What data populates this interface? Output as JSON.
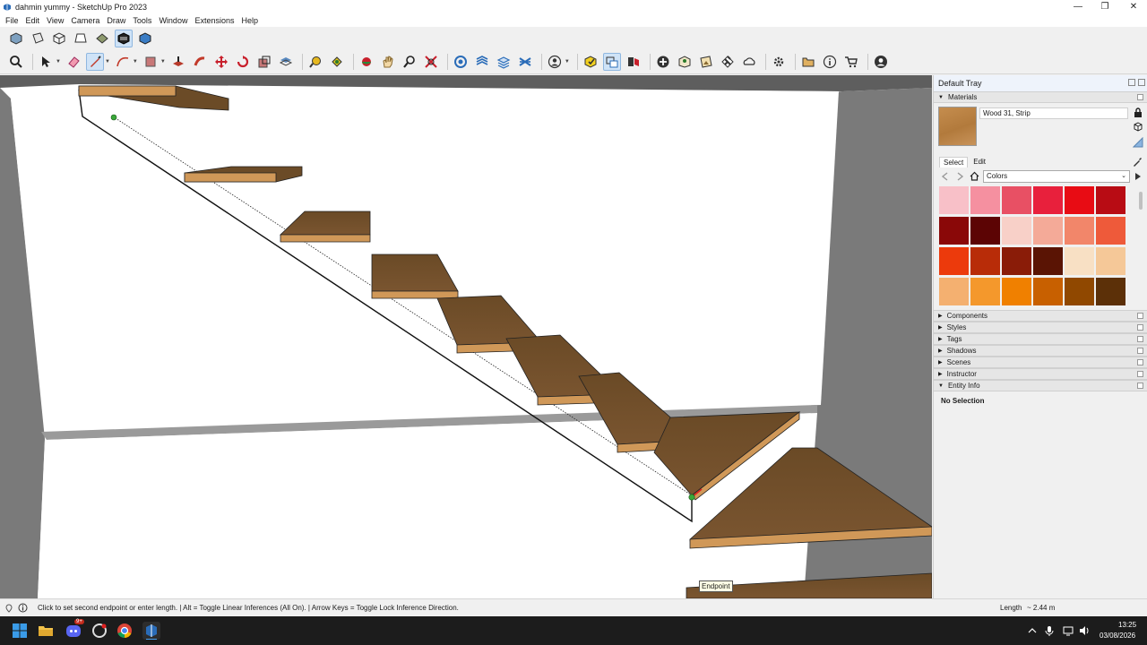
{
  "window": {
    "title": "dahmin yummy - SketchUp Pro 2023"
  },
  "menu": [
    "File",
    "Edit",
    "View",
    "Camera",
    "Draw",
    "Tools",
    "Window",
    "Extensions",
    "Help"
  ],
  "viewport": {
    "inference_tooltip": "Endpoint"
  },
  "tray": {
    "title": "Default Tray",
    "materials": {
      "label": "Materials",
      "current_material": "Wood 31, Strip",
      "tab_select": "Select",
      "tab_edit": "Edit",
      "library": "Colors",
      "swatches": [
        "#f8c0c8",
        "#f590a0",
        "#e85064",
        "#e8203c",
        "#e80c14",
        "#b80c14",
        "#8a0808",
        "#5c0404",
        "#f8d0c8",
        "#f4aa98",
        "#f2866a",
        "#ee5a3a",
        "#ec3a0c",
        "#b82c08",
        "#8a1c08",
        "#5a1404",
        "#f8e0c4",
        "#f5c898",
        "#f4b070",
        "#f4982c",
        "#f08000",
        "#c86000",
        "#904800",
        "#5c3008"
      ]
    },
    "panels": [
      "Components",
      "Styles",
      "Tags",
      "Shadows",
      "Scenes",
      "Instructor"
    ],
    "entity_info": {
      "label": "Entity Info",
      "value": "No Selection"
    }
  },
  "statusbar": {
    "message": "Click to set second endpoint or enter length. | Alt = Toggle Linear Inferences (All On). | Arrow Keys = Toggle Lock Inference Direction.",
    "measurement_label": "Length",
    "measurement_value": "~ 2.44 m"
  },
  "taskbar": {
    "badge": "9+",
    "time": "13:25",
    "date": "03/08/2026"
  }
}
